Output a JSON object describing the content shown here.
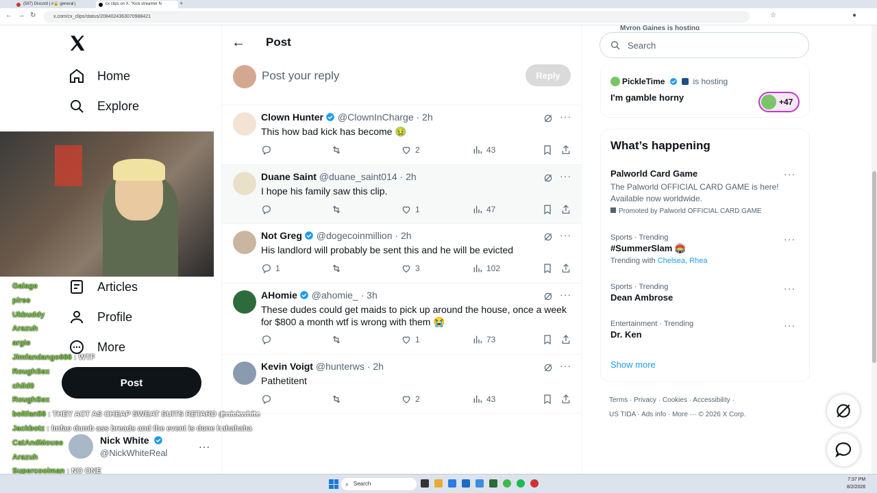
{
  "browser": {
    "tabs": [
      "(587) Discord | #🔓 general |",
      "cx clips on X: \"Kick streamer N",
      "x.com/cx_clips/status"
    ],
    "url": "x.com/cx_clips/status/2084024363070988421"
  },
  "nav": {
    "home": "Home",
    "explore": "Explore",
    "articles": "Articles",
    "profile": "Profile",
    "more": "More",
    "post_button": "Post"
  },
  "account": {
    "name": "Nick White",
    "handle": "@NickWhiteReal"
  },
  "chat": [
    {
      "u": "Galage",
      "m": ""
    },
    {
      "u": "plree",
      "m": ""
    },
    {
      "u": "Ukbuddy",
      "m": ""
    },
    {
      "u": "Arazuh",
      "m": ""
    },
    {
      "u": "argie",
      "m": ""
    },
    {
      "u": "Jimfandango666",
      "m": "WTF"
    },
    {
      "u": "RoughSex",
      "m": ""
    },
    {
      "u": "child0",
      "m": ""
    },
    {
      "u": "RoughSex",
      "m": ""
    },
    {
      "u": "boltfan58",
      "m": "THEY ACT AS CHEAP SWEAT SUITS RETARD @nickwhite"
    },
    {
      "u": "Jackbotz",
      "m": "lmfao dumb ass breads and the event is done hahahaha"
    },
    {
      "u": "CatAndMouse",
      "m": ""
    },
    {
      "u": "Arazuh",
      "m": ""
    },
    {
      "u": "Supercoolman",
      "m": "NO ONE"
    },
    {
      "u": "RoughSex",
      "m": ""
    }
  ],
  "header": {
    "title": "Post",
    "reply_placeholder": "Post your reply",
    "reply_button": "Reply"
  },
  "tweets": [
    {
      "name": "Clown Hunter",
      "handle": "@ClownInCharge",
      "time": "· 2h",
      "text": "This how bad kick has become 🤢",
      "replies": "",
      "likes": "2",
      "views": "43",
      "verified": true
    },
    {
      "name": "Duane Saint",
      "handle": "@duane_saint014",
      "time": "· 2h",
      "text": "I hope his family saw this clip.",
      "replies": "",
      "likes": "1",
      "views": "47",
      "verified": false
    },
    {
      "name": "Not Greg",
      "handle": "@dogecoinmillion",
      "time": "· 2h",
      "text": "His landlord will probably be sent this and he will be evicted",
      "replies": "1",
      "likes": "3",
      "views": "102",
      "verified": true
    },
    {
      "name": "AHomie",
      "handle": "@ahomie_",
      "time": "· 3h",
      "text": "These dudes could get maids to pick up around the house, once a week for $800 a month wtf is wrong with them 😭",
      "replies": "",
      "likes": "1",
      "views": "73",
      "verified": true
    },
    {
      "name": "Kevin Voigt",
      "handle": "@hunterws",
      "time": "· 2h",
      "text": "Pathetitent",
      "replies": "",
      "likes": "2",
      "views": "43",
      "verified": false
    }
  ],
  "right": {
    "search_placeholder": "Search",
    "space_partial": "Myron Gaines is hosting",
    "space_host": "PickleTime",
    "space_status": "is hosting",
    "space_title": "I'm gamble horny",
    "space_count": "+47",
    "happening_title": "What’s happening",
    "trends": [
      {
        "cat": "",
        "title": "Palworld Card Game",
        "desc": "The Palworld OFFICIAL CARD GAME is here! Available now worldwide.",
        "promo": "Promoted by Palworld OFFICIAL CARD GAME"
      },
      {
        "cat": "Sports · Trending",
        "title": "#SummerSlam 🏟️",
        "with_label": "Trending with",
        "with": "Chelsea, Rhea"
      },
      {
        "cat": "Sports · Trending",
        "title": "Dean Ambrose"
      },
      {
        "cat": "Entertainment · Trending",
        "title": "Dr. Ken"
      }
    ],
    "show_more": "Show more",
    "footer": [
      "Terms",
      "Privacy",
      "Cookies",
      "Accessibility",
      "US TIDA",
      "Ads info",
      "More ···",
      "© 2026 X Corp."
    ]
  },
  "taskbar": {
    "search": "Search",
    "time": "7:37 PM",
    "date": "8/2/2026"
  },
  "colors": {
    "accent": "#1d9bf0",
    "text": "#0f1419",
    "muted": "#536471"
  }
}
